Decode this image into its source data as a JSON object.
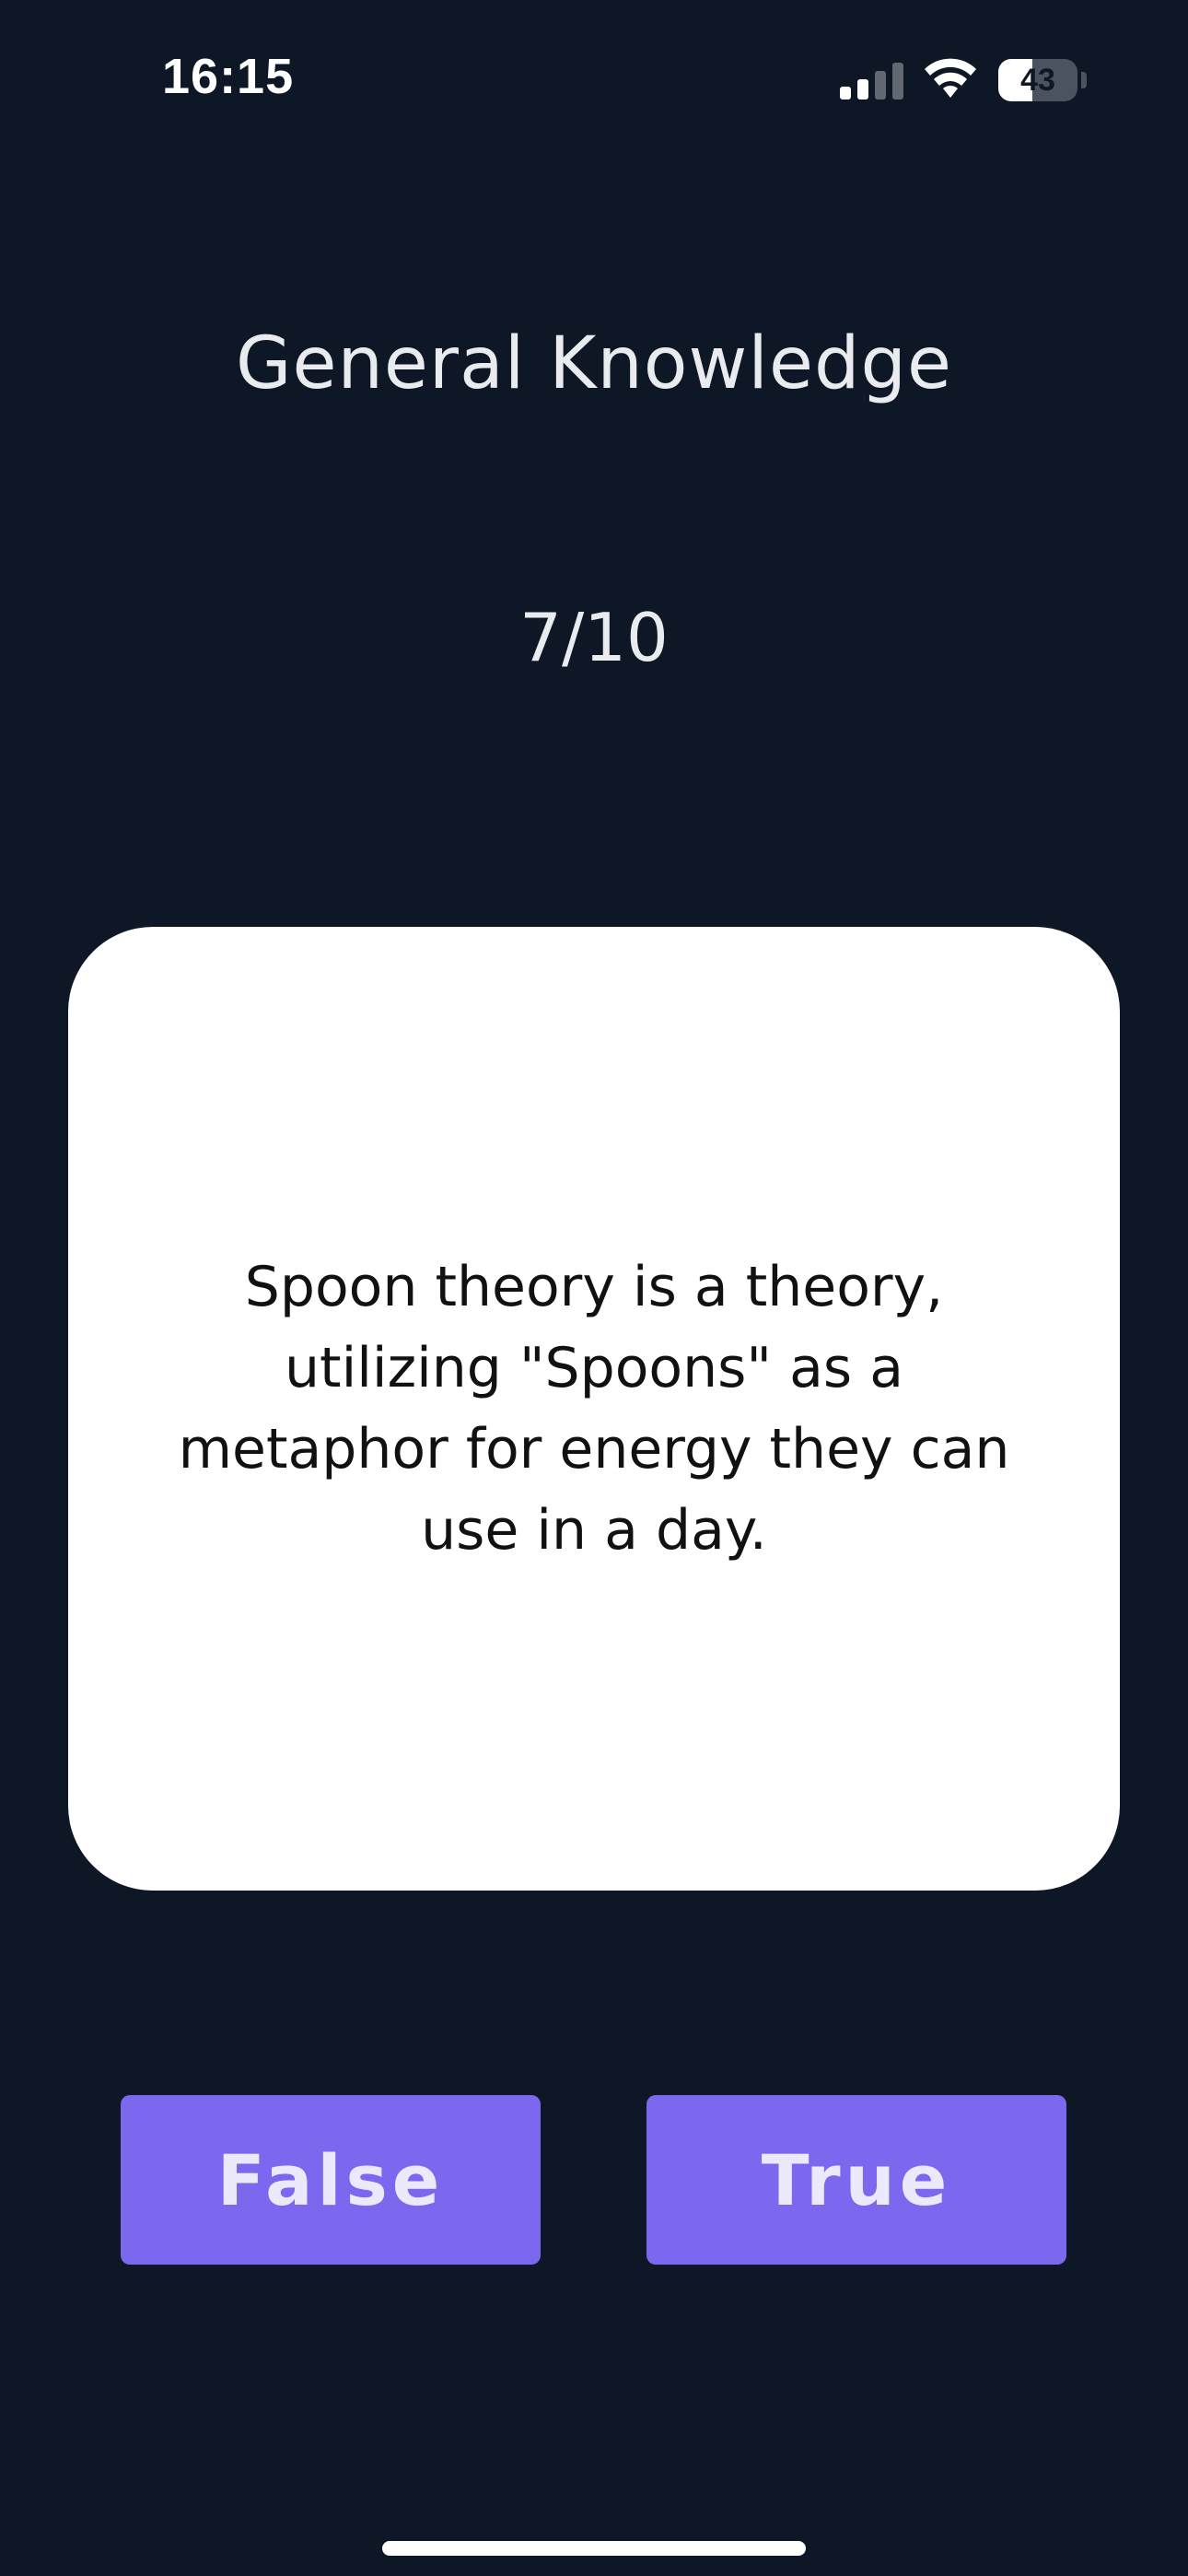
{
  "status_bar": {
    "time": "16:15",
    "battery_level": "43",
    "signal_icon": "cellular-signal-icon",
    "wifi_icon": "wifi-icon",
    "battery_icon": "battery-icon"
  },
  "quiz": {
    "title": "General Knowledge",
    "progress": "7/10",
    "question": "Spoon theory is a theory, utilizing \"Spoons\" as a metaphor for energy they can use in a day."
  },
  "answers": {
    "false_label": "False",
    "true_label": "True"
  },
  "colors": {
    "background": "#0d1726",
    "card": "#ffffff",
    "button": "#7b68ee",
    "text_light": "#e9ebef"
  }
}
